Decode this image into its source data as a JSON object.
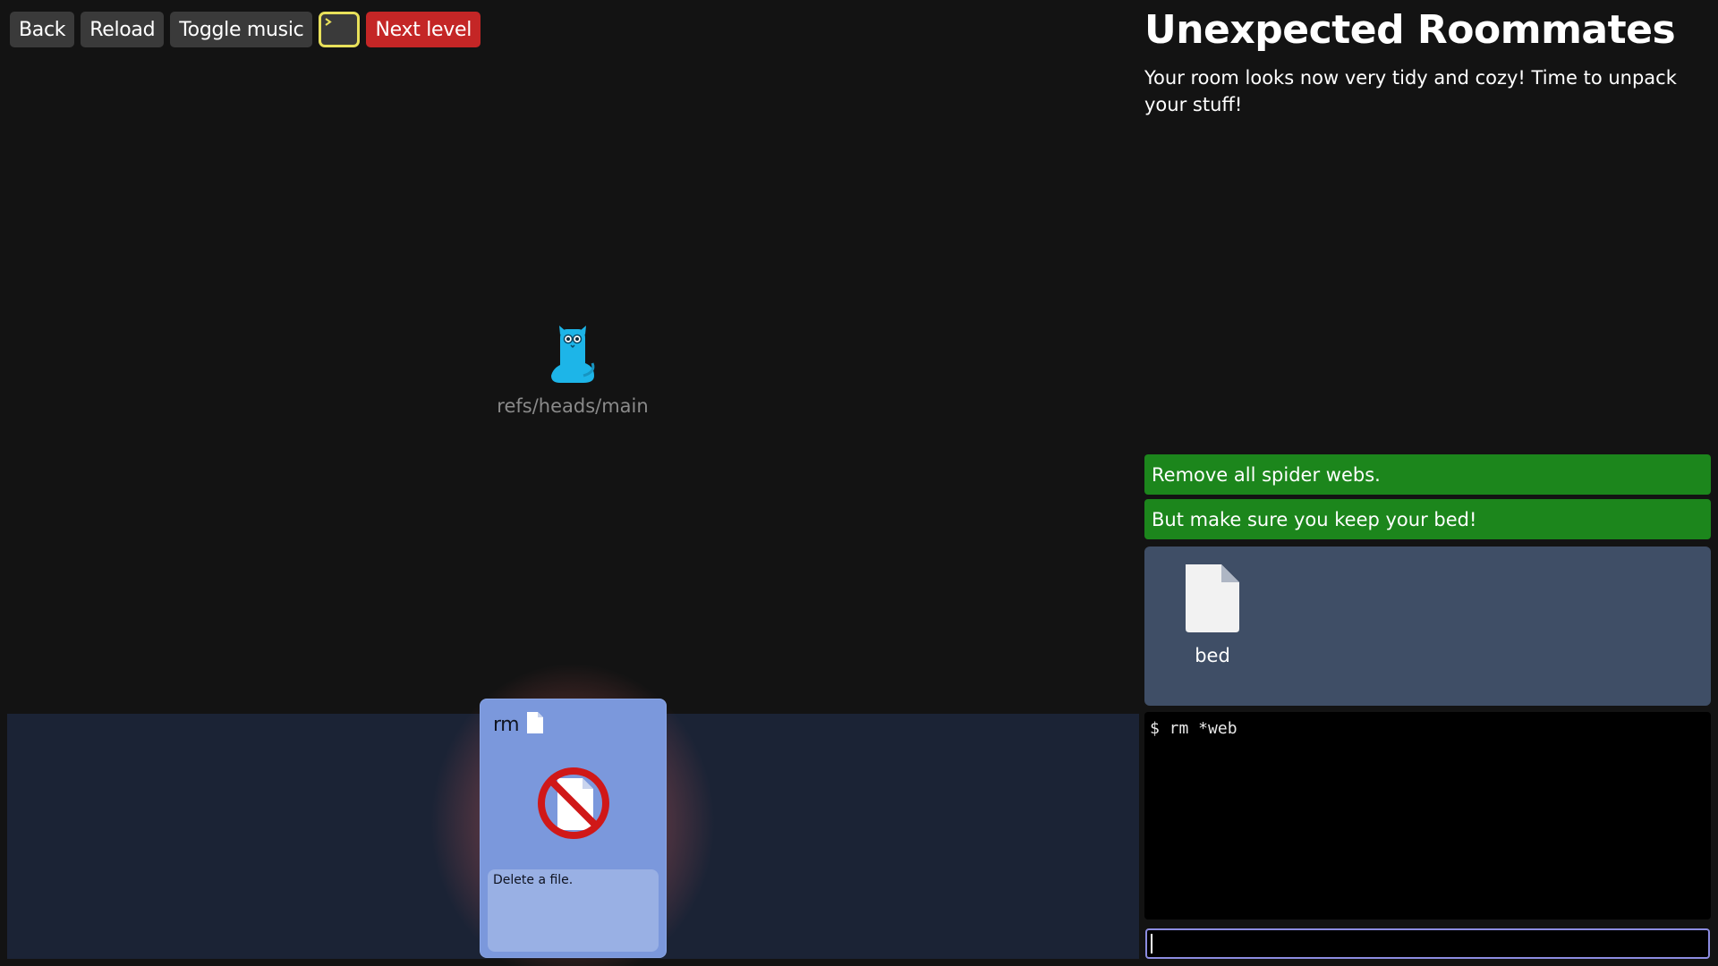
{
  "toolbar": {
    "back_label": "Back",
    "reload_label": "Reload",
    "toggle_music_label": "Toggle music",
    "terminal_icon": "terminal-icon",
    "next_level_label": "Next level"
  },
  "graph": {
    "head_icon": "git-octocat-icon",
    "head_ref": "refs/heads/main"
  },
  "card": {
    "title": "rm",
    "title_icon": "file-icon",
    "image_icon": "delete-file-icon",
    "description": "Delete a file."
  },
  "level": {
    "title": "Unexpected Roommates",
    "description": "Your room looks now very tidy and cozy! Time to unpack your stuff!"
  },
  "goals": [
    {
      "text": "Remove all spider webs.",
      "done": true
    },
    {
      "text": "But make sure you keep your bed!",
      "done": true
    }
  ],
  "room": {
    "files": [
      {
        "name": "bed",
        "icon": "file-icon"
      }
    ]
  },
  "terminal": {
    "output": "$ rm *web",
    "input_value": ""
  },
  "colors": {
    "background": "#131313",
    "goal_done": "#1c861c",
    "next_level": "#c42626",
    "card": "#7b98dc",
    "room": "#3f4e66"
  }
}
